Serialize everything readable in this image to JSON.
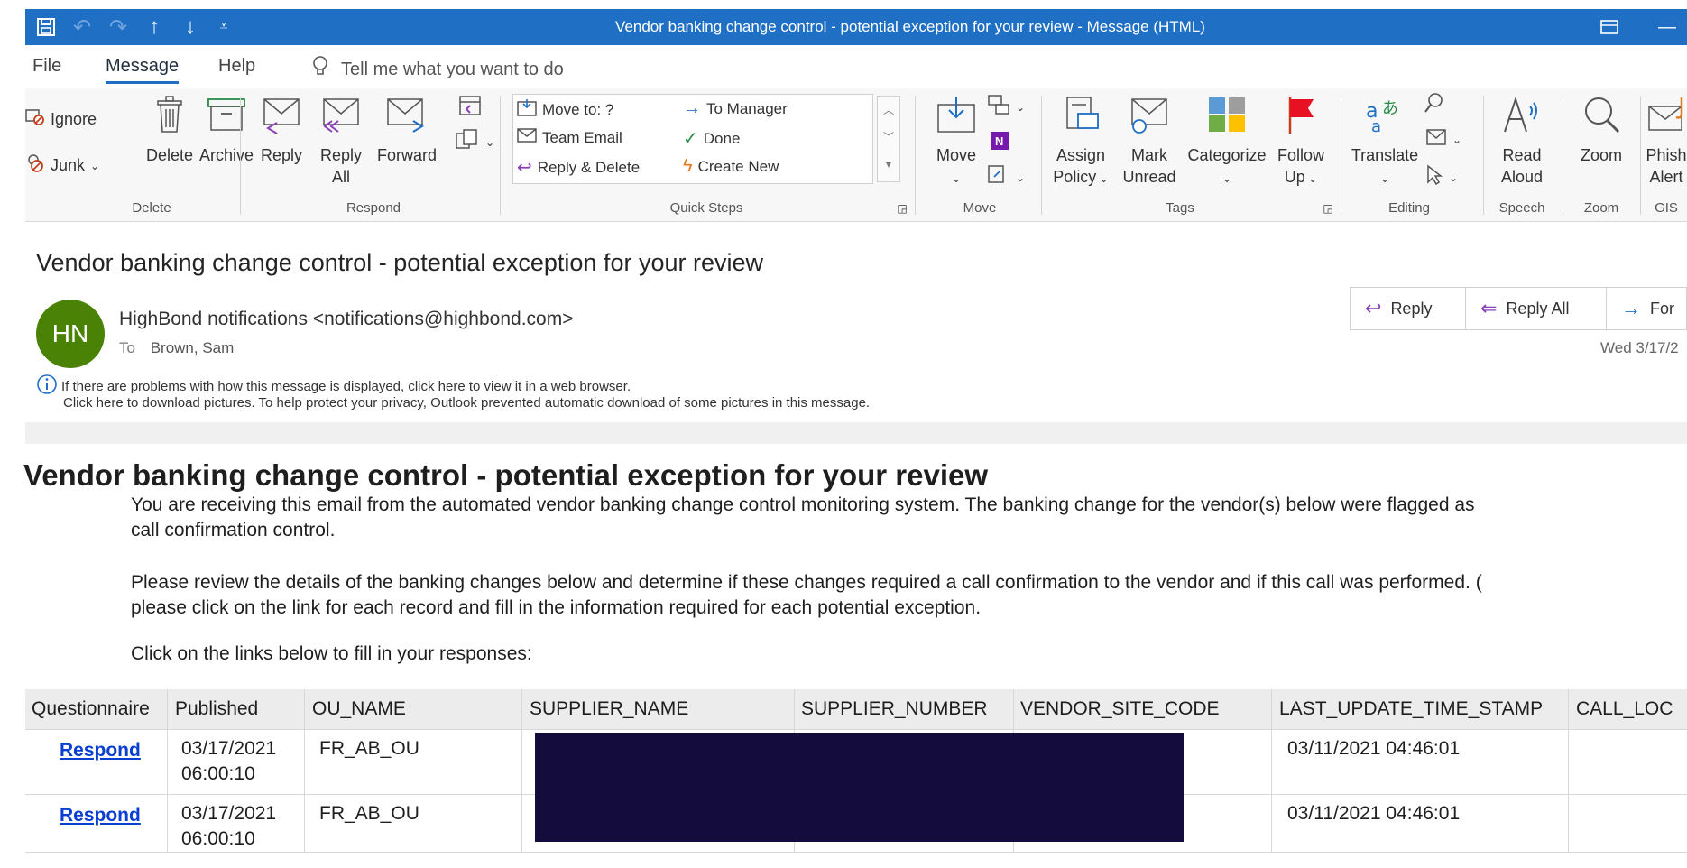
{
  "window": {
    "title": "Vendor banking change control - potential exception for your review  -  Message (HTML)"
  },
  "menu": {
    "tabs": [
      "File",
      "Message",
      "Help"
    ],
    "active_tab": "Message",
    "tell_me": "Tell me what you want to do"
  },
  "ribbon": {
    "delete_group": {
      "label": "Delete",
      "ignore": "Ignore",
      "junk": "Junk",
      "delete": "Delete",
      "archive": "Archive"
    },
    "respond_group": {
      "label": "Respond",
      "reply": "Reply",
      "reply_all_1": "Reply",
      "reply_all_2": "All",
      "forward": "Forward"
    },
    "quick_steps": {
      "label": "Quick Steps",
      "items": [
        "Move to: ?",
        "Team Email",
        "Reply & Delete",
        "To Manager",
        "Done",
        "Create New"
      ]
    },
    "move_group": {
      "label": "Move",
      "move": "Move"
    },
    "tags_group": {
      "label": "Tags",
      "assign_1": "Assign",
      "assign_2": "Policy",
      "mark_1": "Mark",
      "mark_2": "Unread",
      "categorize": "Categorize",
      "follow_1": "Follow",
      "follow_2": "Up"
    },
    "editing_group": {
      "label": "Editing",
      "translate": "Translate"
    },
    "speech_group": {
      "label": "Speech",
      "read_1": "Read",
      "read_2": "Aloud"
    },
    "zoom_group": {
      "label": "Zoom",
      "zoom": "Zoom"
    },
    "gis_group": {
      "label": "GIS",
      "phish_1": "Phish",
      "phish_2": "Alert"
    }
  },
  "message": {
    "subject": "Vendor banking change control - potential exception for your review",
    "avatar_initials": "HN",
    "avatar_color": "#498205",
    "sender": "HighBond notifications <notifications@highbond.com>",
    "to_label": "To",
    "to": "Brown, Sam",
    "date": "Wed 3/17/2",
    "actions": {
      "reply": "Reply",
      "reply_all": "Reply All",
      "forward": "For"
    },
    "info_line1": "If there are problems with how this message is displayed, click here to view it in a web browser.",
    "info_line2": "Click here to download pictures. To help protect your privacy, Outlook prevented automatic download of some pictures in this message."
  },
  "body": {
    "heading": "Vendor banking change control - potential exception for your review",
    "p1_line1": "You are receiving this email from the automated vendor banking change control monitoring system. The banking change for the vendor(s) below were flagged as",
    "p1_line2": "call confirmation control.",
    "p2_line1": "Please review the details of the banking changes below and determine if these changes required a call confirmation to the vendor and if this call was performed. (",
    "p2_line2": "please click on the link for each record and fill in the information required for each potential exception.",
    "p3": "Click on the links below to fill in your responses:"
  },
  "table": {
    "headers": [
      "Questionnaire",
      "Published",
      "OU_NAME",
      "SUPPLIER_NAME",
      "SUPPLIER_NUMBER",
      "VENDOR_SITE_CODE",
      "LAST_UPDATE_TIME_STAMP",
      "CALL_LOC"
    ],
    "rows": [
      {
        "questionnaire": "Respond",
        "published_1": "03/17/2021",
        "published_2": "06:00:10",
        "ou_name": "FR_AB_OU",
        "last_update": "03/11/2021 04:46:01"
      },
      {
        "questionnaire": "Respond",
        "published_1": "03/17/2021",
        "published_2": "06:00:10",
        "ou_name": "FR_AB_OU",
        "last_update": "03/11/2021 04:46:01"
      }
    ]
  },
  "colors": {
    "accent": "#1f6fc5",
    "link": "#0a3fd1",
    "redaction": "#140c3d"
  }
}
